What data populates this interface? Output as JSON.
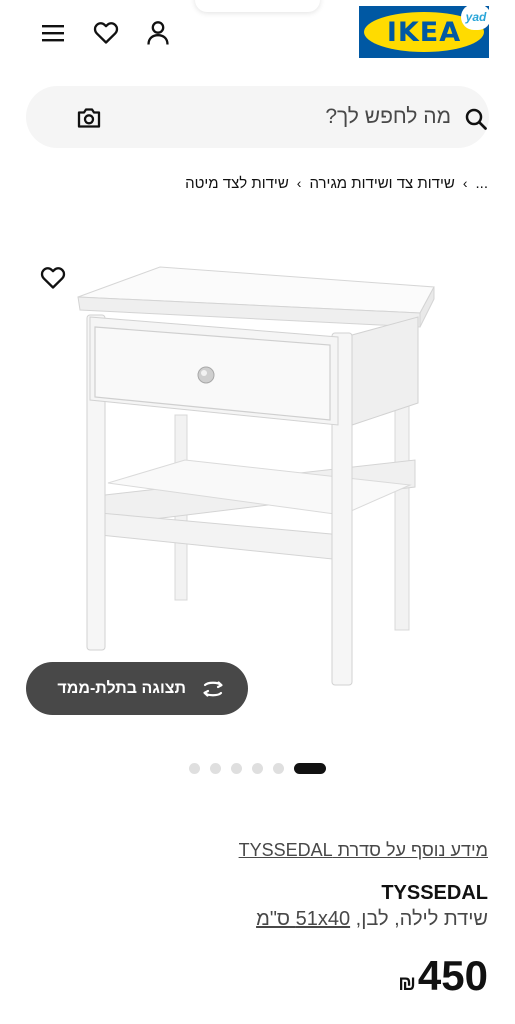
{
  "header": {
    "logo_text": "IKEA",
    "badge_text": "yad",
    "icons": [
      "menu-icon",
      "heart-icon",
      "user-icon"
    ]
  },
  "search": {
    "placeholder": "מה לחפש לך?",
    "icons": [
      "search-icon",
      "camera-icon"
    ]
  },
  "breadcrumb": {
    "items": [
      "...",
      "שידות צד ושידות מגירה",
      "שידות לצד מיטה"
    ],
    "separator": "›"
  },
  "gallery": {
    "view_3d_label": "תצוגה בתלת-ממד",
    "total_images": 6,
    "active_index": 0
  },
  "product": {
    "series_link": "מידע נוסף על סדרת TYSSEDAL",
    "name": "TYSSEDAL",
    "description": "שידת לילה, לבן,",
    "dimensions": "51x40 ס\"מ",
    "price": "450",
    "currency": "₪"
  },
  "colors": {
    "brand_blue": "#0058a3",
    "brand_yellow": "#ffdb00",
    "button_dark": "#484848",
    "search_bg": "#f5f5f5"
  }
}
